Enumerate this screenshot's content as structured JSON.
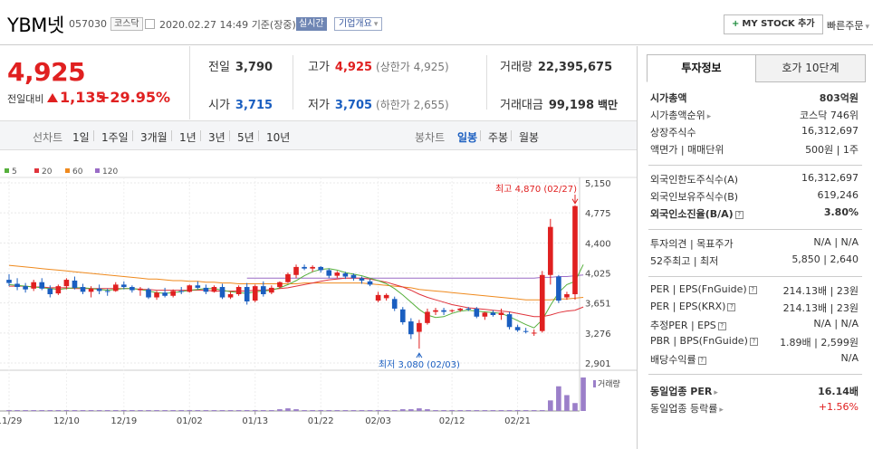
{
  "header": {
    "name": "YBM넷",
    "code": "057030",
    "market": "코스닥",
    "timestamp": "2020.02.27 14:49",
    "basis": "기준(장중)",
    "realtime_badge": "실시간",
    "company_info_button": "기업개요",
    "my_stock_button": "MY STOCK 추가",
    "quick_order": "빠른주문"
  },
  "price": {
    "current": "4,925",
    "change_label": "전일대비",
    "change": "1,135",
    "change_pct": "+29.95%"
  },
  "stats": {
    "prev_close_label": "전일",
    "prev_close": "3,790",
    "high_label": "고가",
    "high": "4,925",
    "upper_limit": "(상한가 4,925)",
    "volume_label": "거래량",
    "volume": "22,395,675",
    "open_label": "시가",
    "open": "3,715",
    "low_label": "저가",
    "low": "3,705",
    "lower_limit": "(하한가 2,655)",
    "amount_label": "거래대금",
    "amount": "99,198",
    "amount_unit": "백만"
  },
  "toolbar": {
    "line_chart": "선차트",
    "ranges": [
      "1일",
      "1주일",
      "3개월",
      "1년",
      "3년",
      "5년",
      "10년"
    ],
    "candle_chart": "봉차트",
    "periods": [
      "일봉",
      "주봉",
      "월봉"
    ],
    "selected_period": "일봉"
  },
  "colors": {
    "up": "#e02020",
    "down": "#1a5ec0",
    "ma5": "#56b03c",
    "ma20": "#e0343c",
    "ma60": "#ef8a1e",
    "ma120": "#9a6cc6"
  },
  "chart_data": {
    "type": "candlestick",
    "legend": [
      "5",
      "20",
      "60",
      "120"
    ],
    "y_ticks": [
      "5,150",
      "4,775",
      "4,400",
      "4,025",
      "3,651",
      "3,276",
      "2,901"
    ],
    "ylim": [
      2901,
      5150
    ],
    "x_ticks": [
      "11/29",
      "12/10",
      "12/19",
      "01/02",
      "01/13",
      "01/22",
      "02/03",
      "02/12",
      "02/21"
    ],
    "high_annotation": "최고 4,870 (02/27)",
    "low_annotation": "최저 3,080 (02/03)",
    "volume_label": "거래량",
    "candles": [
      {
        "o": 3940,
        "h": 4010,
        "l": 3860,
        "c": 3900
      },
      {
        "o": 3890,
        "h": 3960,
        "l": 3810,
        "c": 3850
      },
      {
        "o": 3860,
        "h": 3900,
        "l": 3780,
        "c": 3820
      },
      {
        "o": 3830,
        "h": 3940,
        "l": 3800,
        "c": 3910
      },
      {
        "o": 3910,
        "h": 3960,
        "l": 3810,
        "c": 3830
      },
      {
        "o": 3830,
        "h": 3870,
        "l": 3720,
        "c": 3760
      },
      {
        "o": 3770,
        "h": 3880,
        "l": 3750,
        "c": 3860
      },
      {
        "o": 3860,
        "h": 3960,
        "l": 3820,
        "c": 3940
      },
      {
        "o": 3930,
        "h": 3980,
        "l": 3820,
        "c": 3840
      },
      {
        "o": 3850,
        "h": 3890,
        "l": 3760,
        "c": 3790
      },
      {
        "o": 3790,
        "h": 3860,
        "l": 3720,
        "c": 3830
      },
      {
        "o": 3830,
        "h": 3880,
        "l": 3760,
        "c": 3800
      },
      {
        "o": 3800,
        "h": 3830,
        "l": 3740,
        "c": 3790
      },
      {
        "o": 3800,
        "h": 3910,
        "l": 3790,
        "c": 3880
      },
      {
        "o": 3880,
        "h": 3920,
        "l": 3820,
        "c": 3850
      },
      {
        "o": 3850,
        "h": 3870,
        "l": 3780,
        "c": 3810
      },
      {
        "o": 3810,
        "h": 3850,
        "l": 3740,
        "c": 3830
      },
      {
        "o": 3820,
        "h": 3840,
        "l": 3700,
        "c": 3720
      },
      {
        "o": 3720,
        "h": 3800,
        "l": 3690,
        "c": 3780
      },
      {
        "o": 3780,
        "h": 3840,
        "l": 3720,
        "c": 3740
      },
      {
        "o": 3740,
        "h": 3820,
        "l": 3720,
        "c": 3800
      },
      {
        "o": 3800,
        "h": 3850,
        "l": 3760,
        "c": 3790
      },
      {
        "o": 3790,
        "h": 3880,
        "l": 3780,
        "c": 3870
      },
      {
        "o": 3870,
        "h": 3920,
        "l": 3820,
        "c": 3840
      },
      {
        "o": 3840,
        "h": 3880,
        "l": 3760,
        "c": 3790
      },
      {
        "o": 3790,
        "h": 3870,
        "l": 3780,
        "c": 3850
      },
      {
        "o": 3850,
        "h": 3890,
        "l": 3700,
        "c": 3720
      },
      {
        "o": 3720,
        "h": 3790,
        "l": 3700,
        "c": 3760
      },
      {
        "o": 3760,
        "h": 3870,
        "l": 3740,
        "c": 3850
      },
      {
        "o": 3850,
        "h": 3900,
        "l": 3630,
        "c": 3670
      },
      {
        "o": 3680,
        "h": 3880,
        "l": 3660,
        "c": 3860
      },
      {
        "o": 3860,
        "h": 3920,
        "l": 3730,
        "c": 3760
      },
      {
        "o": 3780,
        "h": 3870,
        "l": 3760,
        "c": 3840
      },
      {
        "o": 3850,
        "h": 3920,
        "l": 3830,
        "c": 3910
      },
      {
        "o": 3910,
        "h": 4030,
        "l": 3900,
        "c": 4010
      },
      {
        "o": 4000,
        "h": 4130,
        "l": 3960,
        "c": 4100
      },
      {
        "o": 4100,
        "h": 4130,
        "l": 4060,
        "c": 4080
      },
      {
        "o": 4080,
        "h": 4120,
        "l": 4040,
        "c": 4100
      },
      {
        "o": 4100,
        "h": 4110,
        "l": 4030,
        "c": 4060
      },
      {
        "o": 4060,
        "h": 4080,
        "l": 3960,
        "c": 3990
      },
      {
        "o": 3990,
        "h": 4050,
        "l": 3960,
        "c": 4030
      },
      {
        "o": 4020,
        "h": 4040,
        "l": 3950,
        "c": 3980
      },
      {
        "o": 4000,
        "h": 4020,
        "l": 3930,
        "c": 3960
      },
      {
        "o": 3960,
        "h": 3980,
        "l": 3890,
        "c": 3930
      },
      {
        "o": 3920,
        "h": 3950,
        "l": 3860,
        "c": 3880
      },
      {
        "o": 3680,
        "h": 3790,
        "l": 3660,
        "c": 3750
      },
      {
        "o": 3710,
        "h": 3770,
        "l": 3680,
        "c": 3750
      },
      {
        "o": 3700,
        "h": 3730,
        "l": 3550,
        "c": 3580
      },
      {
        "o": 3570,
        "h": 3600,
        "l": 3380,
        "c": 3410
      },
      {
        "o": 3420,
        "h": 3460,
        "l": 3200,
        "c": 3260
      },
      {
        "o": 3290,
        "h": 3440,
        "l": 3080,
        "c": 3400
      },
      {
        "o": 3400,
        "h": 3580,
        "l": 3380,
        "c": 3540
      },
      {
        "o": 3540,
        "h": 3590,
        "l": 3500,
        "c": 3560
      },
      {
        "o": 3560,
        "h": 3590,
        "l": 3500,
        "c": 3540
      },
      {
        "o": 3550,
        "h": 3570,
        "l": 3530,
        "c": 3560
      },
      {
        "o": 3560,
        "h": 3590,
        "l": 3540,
        "c": 3580
      },
      {
        "o": 3580,
        "h": 3600,
        "l": 3550,
        "c": 3570
      },
      {
        "o": 3580,
        "h": 3600,
        "l": 3460,
        "c": 3480
      },
      {
        "o": 3480,
        "h": 3540,
        "l": 3440,
        "c": 3530
      },
      {
        "o": 3530,
        "h": 3560,
        "l": 3480,
        "c": 3500
      },
      {
        "o": 3500,
        "h": 3580,
        "l": 3440,
        "c": 3530
      },
      {
        "o": 3510,
        "h": 3540,
        "l": 3320,
        "c": 3350
      },
      {
        "o": 3350,
        "h": 3380,
        "l": 3290,
        "c": 3310
      },
      {
        "o": 3300,
        "h": 3340,
        "l": 3270,
        "c": 3290
      },
      {
        "o": 3280,
        "h": 3320,
        "l": 3240,
        "c": 3280
      },
      {
        "o": 3300,
        "h": 4050,
        "l": 3280,
        "c": 4000
      },
      {
        "o": 4000,
        "h": 4700,
        "l": 3880,
        "c": 4600
      },
      {
        "o": 3980,
        "h": 4000,
        "l": 3650,
        "c": 3680
      },
      {
        "o": 3720,
        "h": 3790,
        "l": 3690,
        "c": 3760
      },
      {
        "o": 3760,
        "h": 4870,
        "l": 3690,
        "c": 4860
      }
    ],
    "volumes": [
      1,
      1,
      1,
      1,
      1,
      1,
      1,
      1,
      1,
      1,
      1,
      1,
      1,
      1,
      1,
      1,
      1,
      1,
      1,
      1,
      1,
      1,
      1,
      1,
      1,
      1,
      1,
      1,
      1,
      1,
      1,
      1,
      1,
      2,
      3,
      2,
      1,
      1,
      1,
      1,
      1,
      1,
      1,
      1,
      1,
      1,
      1,
      1,
      2,
      2,
      3,
      2,
      1,
      1,
      1,
      1,
      1,
      1,
      1,
      1,
      1,
      1,
      1,
      1,
      1,
      1,
      12,
      28,
      18,
      9,
      38
    ],
    "ma5": [
      3880,
      3870,
      3860,
      3850,
      3840,
      3830,
      3820,
      3830,
      3840,
      3840,
      3830,
      3820,
      3810,
      3820,
      3830,
      3830,
      3820,
      3800,
      3780,
      3770,
      3780,
      3790,
      3810,
      3820,
      3830,
      3830,
      3810,
      3790,
      3780,
      3770,
      3790,
      3800,
      3810,
      3840,
      3880,
      3930,
      3990,
      4040,
      4070,
      4080,
      4060,
      4030,
      4010,
      3990,
      3960,
      3930,
      3890,
      3830,
      3750,
      3660,
      3570,
      3500,
      3470,
      3480,
      3520,
      3550,
      3560,
      3550,
      3540,
      3530,
      3520,
      3480,
      3430,
      3380,
      3340,
      3440,
      3620,
      3780,
      3880,
      3920,
      4130
    ],
    "ma20": [
      3860,
      3860,
      3860,
      3850,
      3850,
      3840,
      3840,
      3840,
      3830,
      3830,
      3830,
      3830,
      3830,
      3830,
      3830,
      3830,
      3820,
      3820,
      3810,
      3810,
      3810,
      3810,
      3810,
      3810,
      3810,
      3800,
      3800,
      3800,
      3800,
      3800,
      3810,
      3810,
      3820,
      3830,
      3840,
      3860,
      3880,
      3900,
      3920,
      3940,
      3950,
      3960,
      3960,
      3960,
      3950,
      3930,
      3910,
      3880,
      3850,
      3810,
      3760,
      3720,
      3690,
      3660,
      3630,
      3610,
      3590,
      3580,
      3570,
      3560,
      3550,
      3540,
      3520,
      3500,
      3480,
      3480,
      3500,
      3530,
      3550,
      3560,
      3600
    ],
    "ma60": [
      4120,
      4110,
      4100,
      4090,
      4080,
      4070,
      4060,
      4050,
      4040,
      4030,
      4020,
      4010,
      4000,
      3990,
      3980,
      3970,
      3960,
      3950,
      3950,
      3940,
      3930,
      3930,
      3920,
      3920,
      3910,
      3910,
      3900,
      3900,
      3890,
      3890,
      3890,
      3890,
      3890,
      3890,
      3890,
      3890,
      3900,
      3900,
      3900,
      3900,
      3900,
      3900,
      3900,
      3900,
      3890,
      3880,
      3870,
      3860,
      3850,
      3840,
      3820,
      3810,
      3800,
      3790,
      3780,
      3770,
      3760,
      3750,
      3740,
      3730,
      3720,
      3710,
      3700,
      3690,
      3690,
      3690,
      3690,
      3700,
      3700,
      3710,
      3720
    ],
    "ma120": [
      null,
      null,
      null,
      null,
      null,
      null,
      null,
      null,
      null,
      null,
      null,
      null,
      null,
      null,
      null,
      null,
      null,
      null,
      null,
      null,
      null,
      null,
      null,
      null,
      null,
      null,
      null,
      null,
      null,
      3960,
      3960,
      3960,
      3960,
      3960,
      3960,
      3960,
      3960,
      3960,
      3960,
      3960,
      3960,
      3960,
      3960,
      3960,
      3960,
      3960,
      3960,
      3960,
      3960,
      3960,
      3960,
      3960,
      3960,
      3960,
      3960,
      3960,
      3960,
      3960,
      3960,
      3960,
      3960,
      3960,
      3960,
      3960,
      3960,
      3970,
      3970,
      3980,
      3980,
      3990,
      4000
    ]
  },
  "side": {
    "tab_info": "투자정보",
    "tab_quote": "호가 10단계",
    "market_cap_label": "시가총액",
    "market_cap": "803억원",
    "rank_label": "시가총액순위",
    "rank": "코스닥 746위",
    "shares_label": "상장주식수",
    "shares": "16,312,697",
    "par_label": "액면가 | 매매단위",
    "par": "500원 | 1주",
    "foreign_limit_label": "외국인한도주식수(A)",
    "foreign_limit": "16,312,697",
    "foreign_hold_label": "외국인보유주식수(B)",
    "foreign_hold": "619,246",
    "foreign_rate_label": "외국인소진율(B/A)",
    "foreign_rate": "3.80%",
    "opinion_label": "투자의견 | 목표주가",
    "opinion": "N/A | N/A",
    "w52_label": "52주최고 | 최저",
    "w52": "5,850 | 2,640",
    "per_fn_label": "PER | EPS(FnGuide)",
    "per_fn": "214.13배 | 23원",
    "per_krx_label": "PER | EPS(KRX)",
    "per_krx": "214.13배 | 23원",
    "est_per_label": "추정PER | EPS",
    "est_per": "N/A | N/A",
    "pbr_label": "PBR | BPS(FnGuide)",
    "pbr": "1.89배 | 2,599원",
    "div_label": "배당수익률",
    "div": "N/A",
    "sector_per_label": "동일업종 PER",
    "sector_per": "16.14배",
    "sector_rate_label": "동일업종 등락률",
    "sector_rate": "+1.56%"
  }
}
